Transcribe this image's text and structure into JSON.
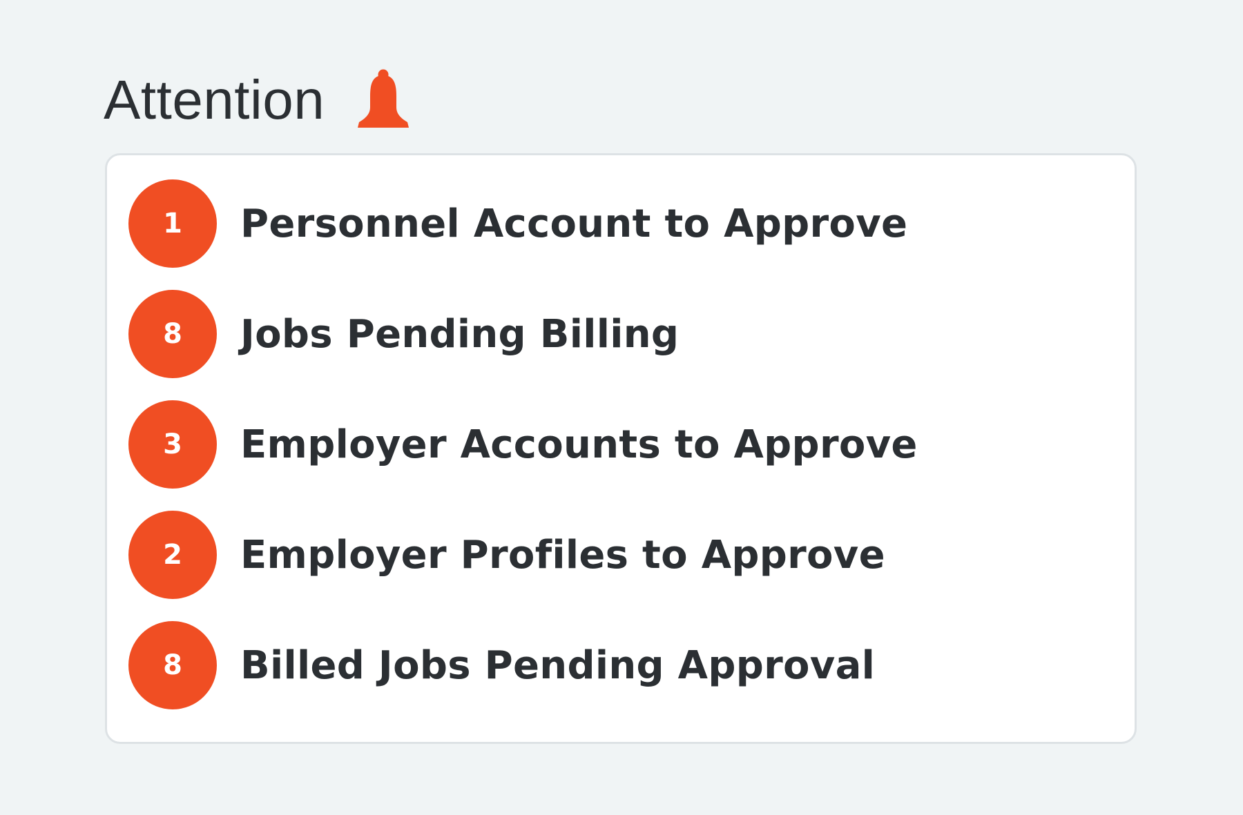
{
  "header": {
    "title": "Attention",
    "icon": "bell-icon"
  },
  "colors": {
    "accent": "#f04e23",
    "text": "#2b2f33",
    "background": "#f0f4f5",
    "card": "#ffffff",
    "card_border": "#dde2e5"
  },
  "attention": {
    "items": [
      {
        "count": "1",
        "label": "Personnel Account to Approve"
      },
      {
        "count": "8",
        "label": "Jobs Pending Billing"
      },
      {
        "count": "3",
        "label": "Employer Accounts to Approve"
      },
      {
        "count": "2",
        "label": "Employer Profiles to Approve"
      },
      {
        "count": "8",
        "label": "Billed Jobs Pending Approval"
      }
    ]
  }
}
